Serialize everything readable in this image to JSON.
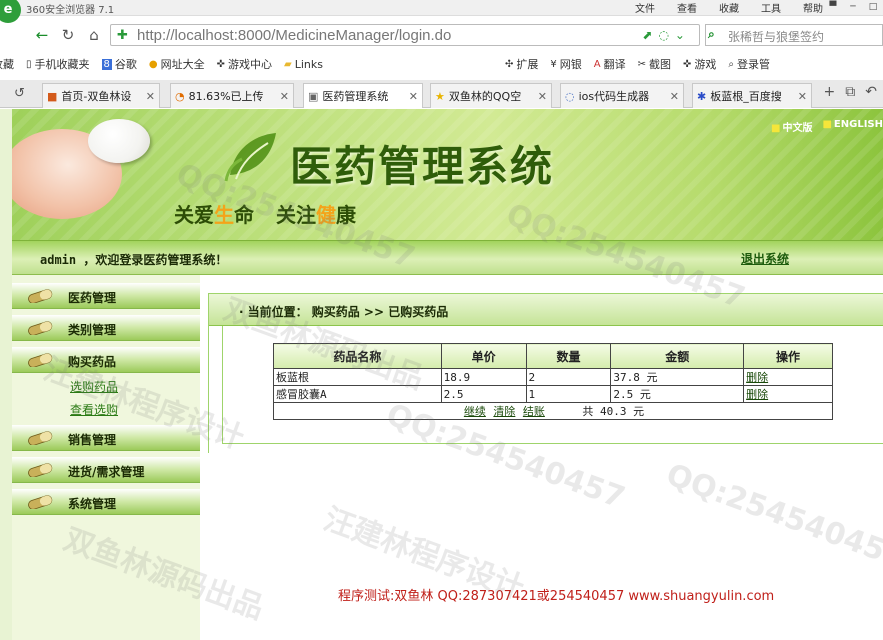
{
  "browser": {
    "title": "360安全浏览器 7.1",
    "menu": [
      "文件",
      "查看",
      "收藏",
      "工具",
      "帮助"
    ],
    "url": "http://localhost:8000/MedicineManager/login.do",
    "search_text": "张稀哲与狼堡签约",
    "bookmarks_left": [
      "收藏",
      "手机收藏夹",
      "谷歌",
      "网址大全",
      "游戏中心",
      "Links"
    ],
    "bookmarks_right": [
      "扩展",
      "网银",
      "翻译",
      "截图",
      "游戏",
      "登录管"
    ],
    "tabs": [
      "首页-双鱼林设",
      "81.63%已上传",
      "医药管理系统",
      "双鱼林的QQ空",
      "ios代码生成器",
      "板蓝根_百度搜"
    ],
    "accent": "#1a8d2a"
  },
  "header": {
    "system_title": "医药管理系统",
    "slogan_a1": "关爱",
    "slogan_a2": "生",
    "slogan_a3": "命",
    "slogan_b1": "关注",
    "slogan_b2": "健",
    "slogan_b3": "康",
    "lang_cn": "中文版",
    "lang_en": "ENGLISH"
  },
  "welcome": {
    "text": "admin ，欢迎登录医药管理系统！",
    "logout": "退出系统"
  },
  "sidebar": {
    "items": [
      {
        "label": "医药管理"
      },
      {
        "label": "类别管理"
      },
      {
        "label": "购买药品"
      },
      {
        "label": "销售管理"
      },
      {
        "label": "进货/需求管理"
      },
      {
        "label": "系统管理"
      }
    ],
    "sub_purchase": [
      "选购药品",
      "查看选购"
    ]
  },
  "main": {
    "location": "当前位置： 购买药品 >> 已购买药品",
    "columns": [
      "药品名称",
      "单价",
      "数量",
      "金额",
      "操作"
    ],
    "rows": [
      {
        "name": "板蓝根",
        "price": "18.9",
        "qty": "2",
        "amount": "37.8 元",
        "action": "删除"
      },
      {
        "name": "感冒胶囊A",
        "price": "2.5",
        "qty": "1",
        "amount": "2.5 元",
        "action": "删除"
      }
    ],
    "footer_links": [
      "继续",
      "清除",
      "结账"
    ],
    "total": "共 40.3  元"
  },
  "footer": {
    "text": "程序测试:双鱼林 QQ:287307421或254540457 www.shuangyulin.com"
  },
  "watermark": {
    "qq": "QQ:254540457",
    "studio": "汪建林程序设计",
    "source": "双鱼林源码出品"
  }
}
